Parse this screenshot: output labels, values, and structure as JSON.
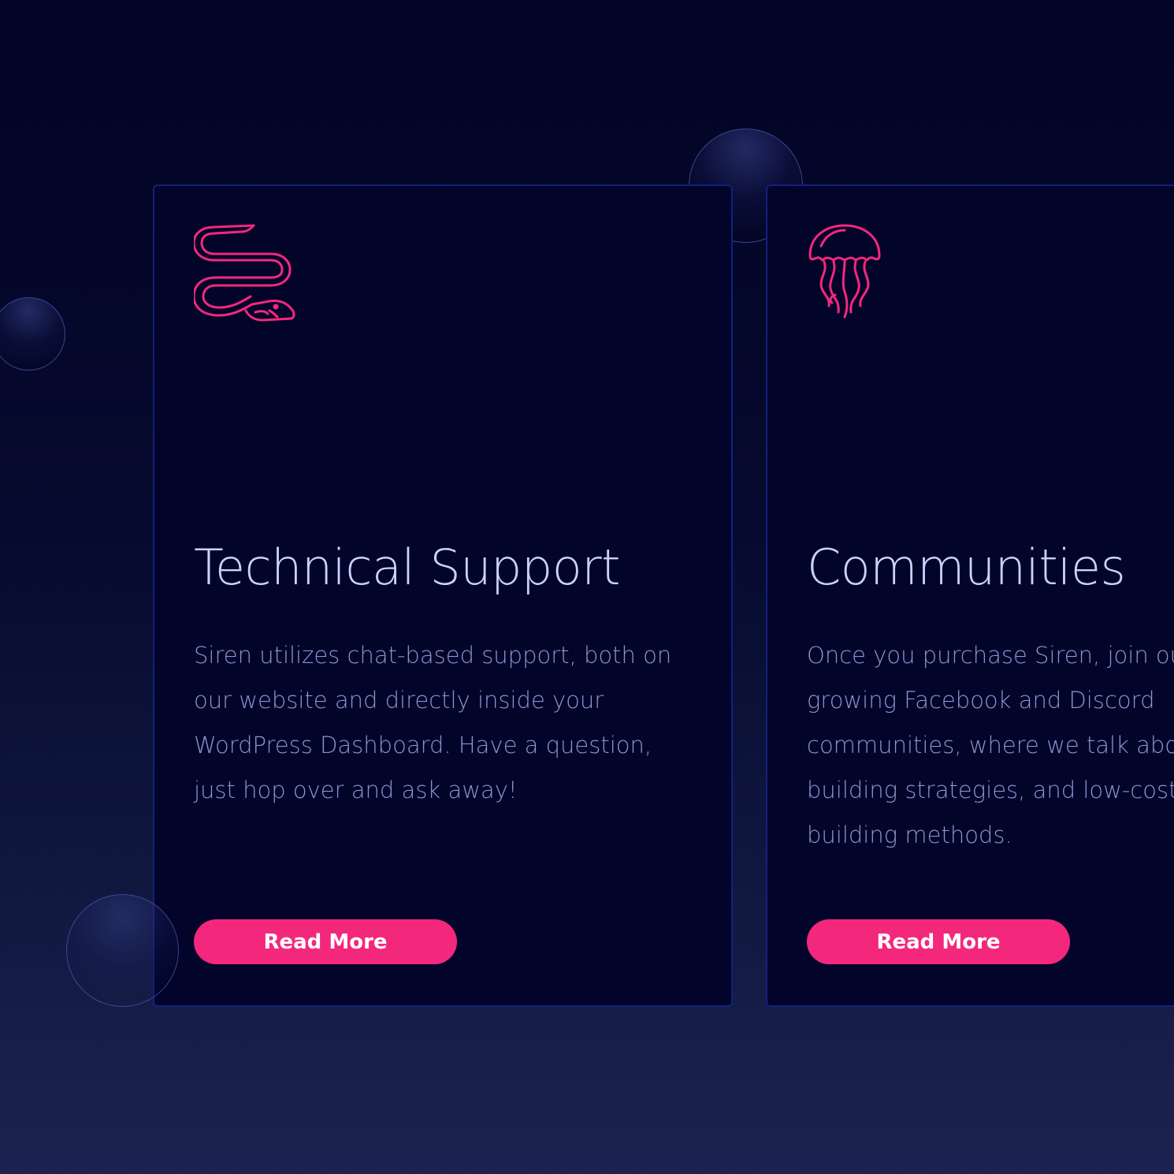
{
  "colors": {
    "background": "#020425",
    "card_background": "#02042a",
    "card_border": "#14207e",
    "accent": "#f3287c",
    "title_text": "#c9d2ff",
    "body_text": "#8b95cf"
  },
  "cards": [
    {
      "icon": "eel-icon",
      "title": "Technical Support",
      "description_lines": [
        "Siren utilizes chat-based support, both on",
        "our website and directly inside your",
        "WordPress Dashboard. Have a question,",
        "just hop over and ask away!"
      ],
      "button_label": "Read More"
    },
    {
      "icon": "jellyfish-icon",
      "title": "Communities",
      "description_lines": [
        "Once you purchase Siren, join our",
        "growing Facebook and Discord",
        "communities, where we talk about",
        "building strategies, and low-cost",
        "building methods."
      ],
      "button_label": "Read More"
    }
  ]
}
